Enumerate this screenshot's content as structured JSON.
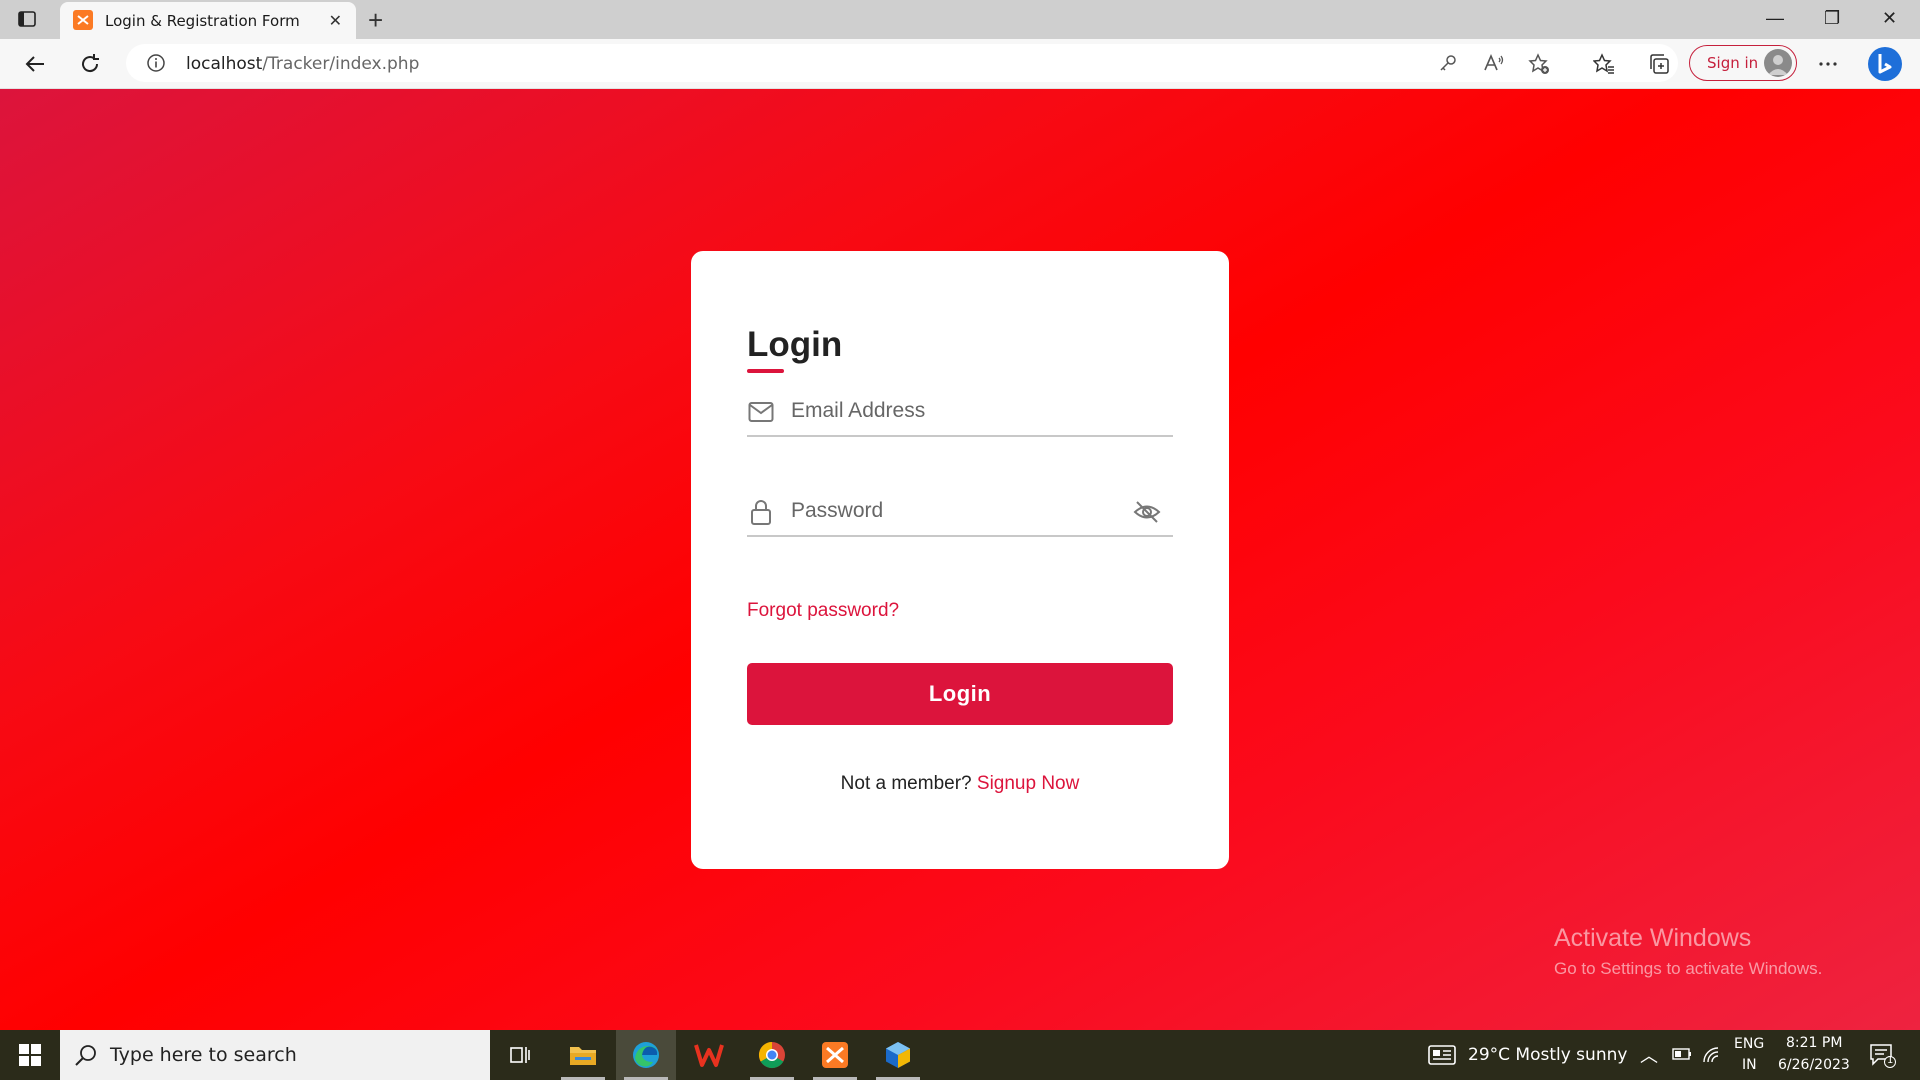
{
  "browser": {
    "tab_title": "Login & Registration Form",
    "url_host": "localhost",
    "url_path": "/Tracker/index.php",
    "signin_label": "Sign in"
  },
  "login": {
    "title": "Login",
    "email_placeholder": "Email Address",
    "password_placeholder": "Password",
    "forgot_label": "Forgot password?",
    "login_button": "Login",
    "not_member": "Not a member?",
    "signup_label": "Signup Now"
  },
  "watermark": {
    "title": "Activate Windows",
    "subtitle": "Go to Settings to activate Windows."
  },
  "taskbar": {
    "search_placeholder": "Type here to search",
    "weather": "29°C  Mostly sunny",
    "language_1": "ENG",
    "language_2": "IN",
    "time": "8:21 PM",
    "date": "6/26/2023",
    "notifications": "1"
  },
  "colors": {
    "accent": "#dc143c",
    "page_gradient": [
      "#dc143c",
      "#ff0000",
      "#ee2340"
    ]
  }
}
